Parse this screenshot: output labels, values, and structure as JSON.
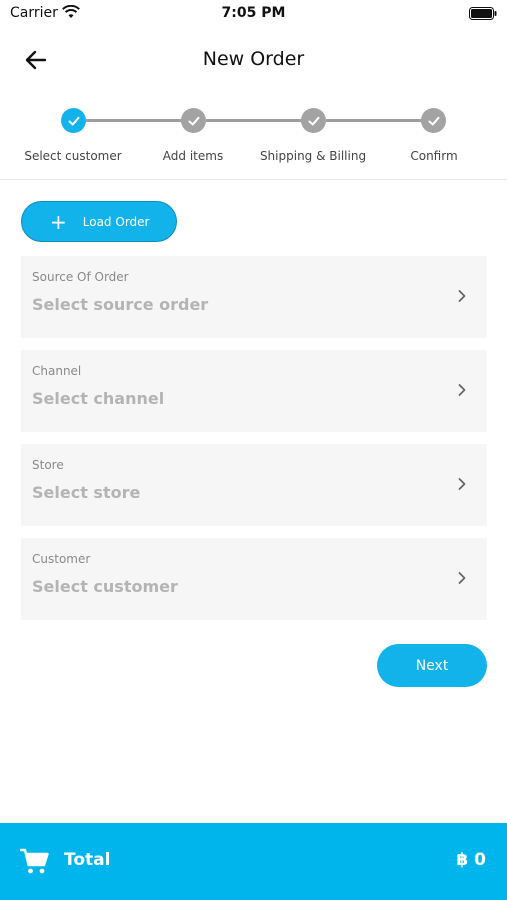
{
  "status_bar": {
    "carrier": "Carrier",
    "time": "7:05 PM"
  },
  "header": {
    "title": "New Order",
    "back_icon": "arrow-left-icon"
  },
  "stepper": {
    "steps": [
      {
        "label": "Select customer",
        "state": "active"
      },
      {
        "label": "Add items",
        "state": "pending"
      },
      {
        "label": "Shipping & Billing",
        "state": "pending"
      },
      {
        "label": "Confirm",
        "state": "pending"
      }
    ]
  },
  "load_order": {
    "label": "Load Order",
    "icon": "plus-icon"
  },
  "fields": [
    {
      "label": "Source Of Order",
      "placeholder": "Select source order"
    },
    {
      "label": "Channel",
      "placeholder": "Select channel"
    },
    {
      "label": "Store",
      "placeholder": "Select store"
    },
    {
      "label": "Customer",
      "placeholder": "Select customer"
    }
  ],
  "next_button": {
    "label": "Next"
  },
  "footer": {
    "total_label": "Total",
    "total_value": "฿ 0",
    "icon": "cart-icon"
  },
  "colors": {
    "accent": "#12b3ea",
    "footer": "#00b4ec",
    "card": "#f6f6f6",
    "step_pending": "#a3a3a3"
  }
}
